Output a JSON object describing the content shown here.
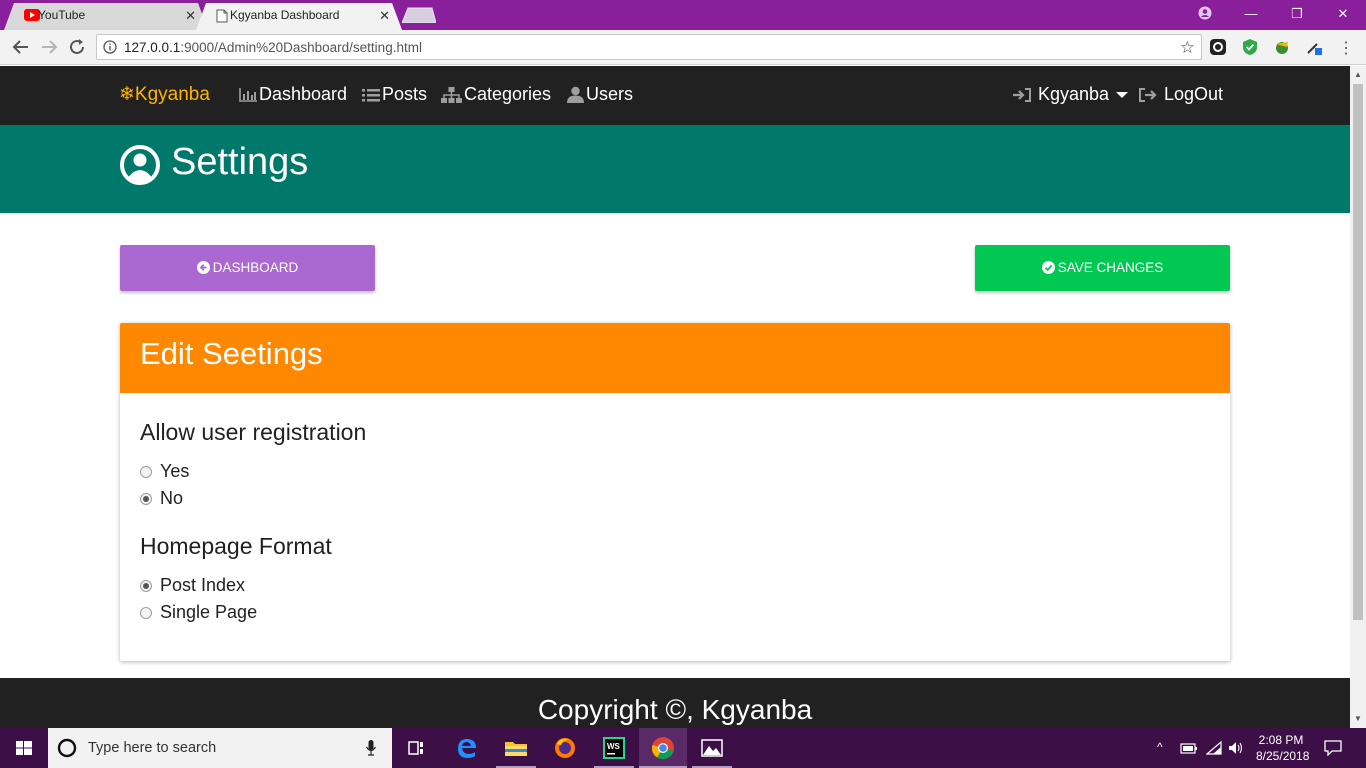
{
  "browser": {
    "tabs": [
      {
        "title": "YouTube",
        "favicon": "youtube-icon"
      },
      {
        "title": "Kgyanba Dashboard",
        "favicon": "page-icon",
        "active": true
      }
    ],
    "url_host": "127.0.0.1",
    "url_rest": ":9000/Admin%20Dashboard/setting.html"
  },
  "nav": {
    "brand": "Kgyanba",
    "links": [
      {
        "label": "Dashboard",
        "icon": "bar-chart-icon"
      },
      {
        "label": "Posts",
        "icon": "list-icon"
      },
      {
        "label": "Categories",
        "icon": "sitemap-icon"
      },
      {
        "label": "Users",
        "icon": "user-icon"
      }
    ],
    "user": "Kgyanba",
    "logout": "LogOut"
  },
  "hero": {
    "title": "Settings"
  },
  "actions": {
    "dashboard": "DASHBOARD",
    "save": "SAVE CHANGES"
  },
  "card": {
    "title": "Edit Seetings",
    "sections": [
      {
        "label": "Allow user registration",
        "options": [
          {
            "label": "Yes",
            "checked": false
          },
          {
            "label": "No",
            "checked": true
          }
        ]
      },
      {
        "label": "Homepage Format",
        "options": [
          {
            "label": "Post Index",
            "checked": true
          },
          {
            "label": "Single Page",
            "checked": false
          }
        ]
      }
    ]
  },
  "footer": {
    "text": "Copyright ©, Kgyanba"
  },
  "taskbar": {
    "search_placeholder": "Type here to search",
    "time": "2:08 PM",
    "date": "8/25/2018"
  },
  "colors": {
    "navbar": "#212121",
    "hero": "#00796b",
    "dashboard_button": "#ab68d0",
    "save_button": "#00c853",
    "card_header": "#ff8800",
    "brand": "#ffb300",
    "browser_frame": "#8a1f9b"
  }
}
